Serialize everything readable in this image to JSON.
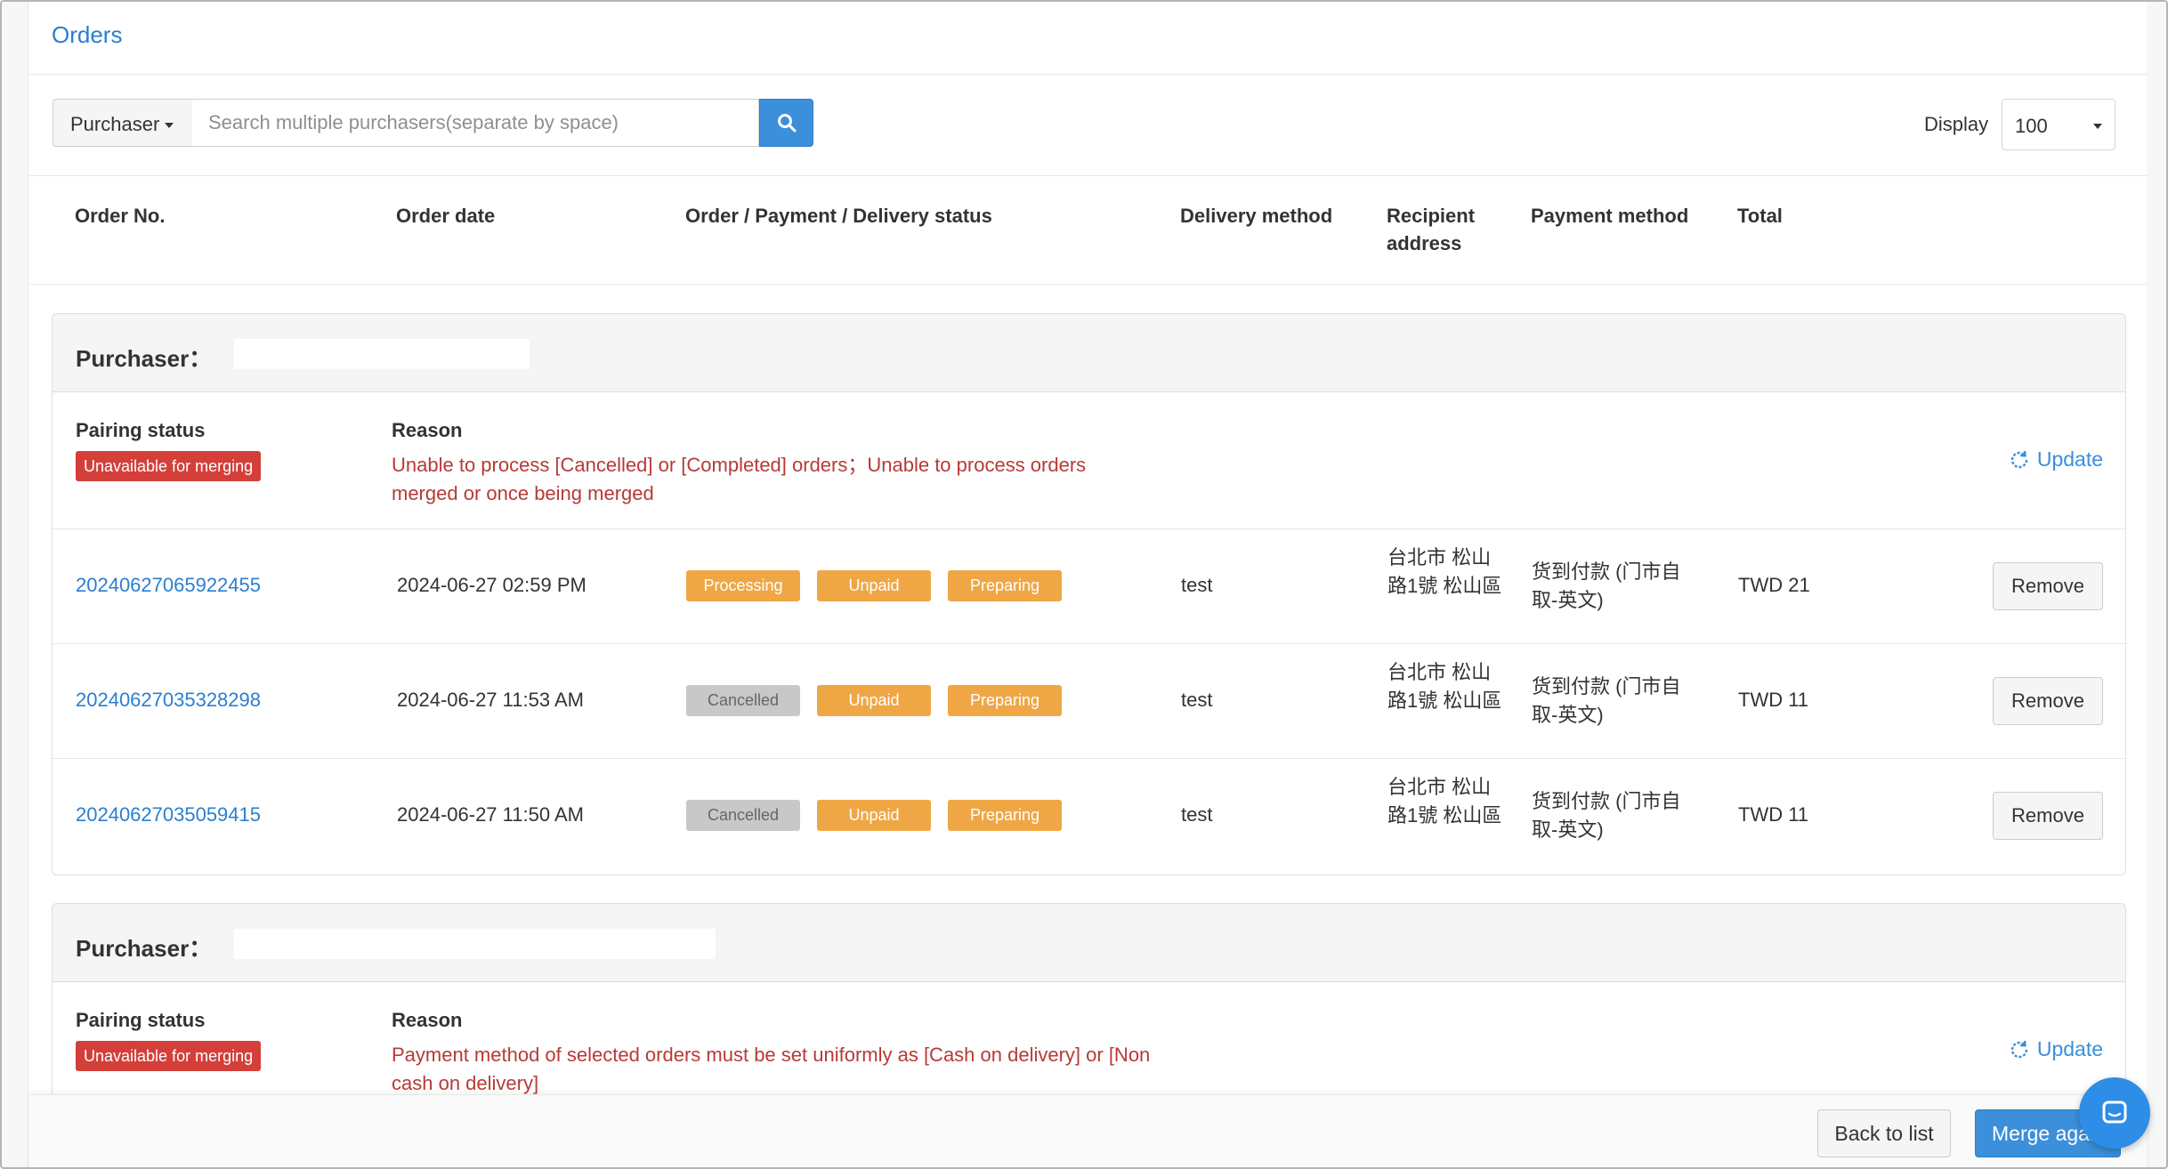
{
  "page": {
    "title": "Orders"
  },
  "toolbar": {
    "filter_label": "Purchaser",
    "search_placeholder": "Search multiple purchasers(separate by space)",
    "display_label": "Display",
    "display_value": "100"
  },
  "columns": {
    "order_no": "Order No.",
    "order_date": "Order date",
    "status": "Order / Payment / Delivery status",
    "delivery_method": "Delivery method",
    "recipient_address": "Recipient address",
    "payment_method": "Payment method",
    "total": "Total"
  },
  "groups": [
    {
      "purchaser_label": "Purchaser：",
      "pairing_label": "Pairing status",
      "pairing_status": "Unavailable for merging",
      "reason_label": "Reason",
      "reason": "Unable to process [Cancelled] or [Completed] orders；Unable to process orders merged or once being merged",
      "update_label": "Update",
      "orders": [
        {
          "order_no": "20240627065922455",
          "date": "2024-06-27 02:59 PM",
          "order_status": "Processing",
          "payment_status": "Unpaid",
          "delivery_status": "Preparing",
          "delivery_method": "test",
          "address": "台北市 松山路1號 松山區",
          "payment_method": "货到付款 (门市自取-英文)",
          "total": "TWD 21",
          "remove_label": "Remove"
        },
        {
          "order_no": "20240627035328298",
          "date": "2024-06-27 11:53 AM",
          "order_status": "Cancelled",
          "payment_status": "Unpaid",
          "delivery_status": "Preparing",
          "delivery_method": "test",
          "address": "台北市 松山路1號 松山區",
          "payment_method": "货到付款 (门市自取-英文)",
          "total": "TWD 11",
          "remove_label": "Remove"
        },
        {
          "order_no": "20240627035059415",
          "date": "2024-06-27 11:50 AM",
          "order_status": "Cancelled",
          "payment_status": "Unpaid",
          "delivery_status": "Preparing",
          "delivery_method": "test",
          "address": "台北市 松山路1號 松山區",
          "payment_method": "货到付款 (门市自取-英文)",
          "total": "TWD 11",
          "remove_label": "Remove"
        }
      ]
    },
    {
      "purchaser_label": "Purchaser：",
      "pairing_label": "Pairing status",
      "pairing_status": "Unavailable for merging",
      "reason_label": "Reason",
      "reason": "Payment method of selected orders must be set uniformly as [Cash on delivery] or [Non cash on delivery]",
      "update_label": "Update"
    }
  ],
  "footer": {
    "back_label": "Back to list",
    "merge_label": "Merge again"
  },
  "icons": {
    "search": "search-icon",
    "update": "refresh-icon",
    "chat": "chat-icon"
  },
  "colors": {
    "accent": "#3b8fdb",
    "link": "#2a7fd0",
    "danger": "#d43f3a",
    "warning": "#efa745",
    "muted": "#c8c8c8"
  }
}
